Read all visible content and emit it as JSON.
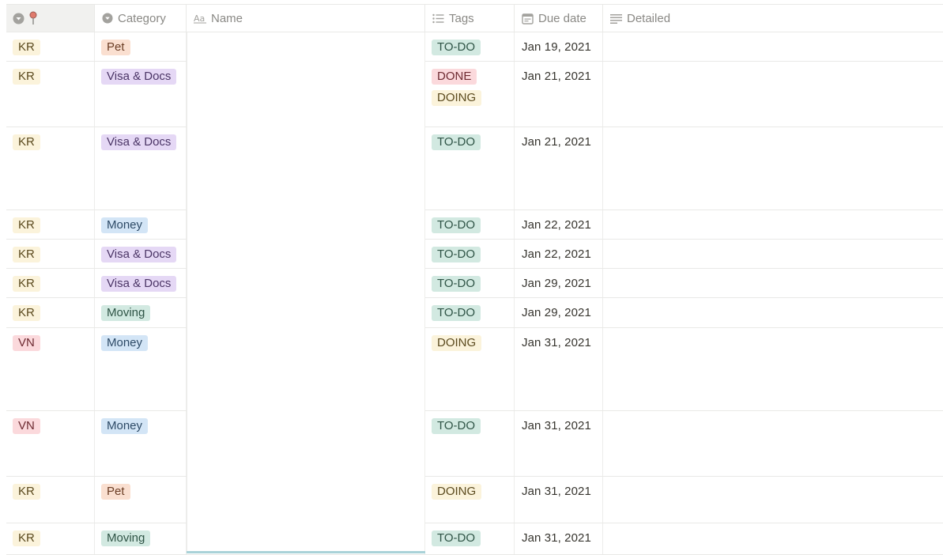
{
  "colors": {
    "yellow_bg": "#fbf3db",
    "yellow_fg": "#5b4a1e",
    "red_bg": "#fbd9dc",
    "red_fg": "#6e2b32",
    "orange_bg": "#fadfd0",
    "orange_fg": "#6b3d25",
    "purple_bg": "#e5d8f5",
    "purple_fg": "#4b3566",
    "blue_bg": "#d3e5f6",
    "blue_fg": "#2d4a66",
    "green_bg": "#d2e9e1",
    "green_fg": "#2f5446",
    "accent_strip": "#a9d2d8"
  },
  "header": {
    "region_icons": [
      "chevron-down-circle-icon",
      "pin-icon"
    ],
    "category": {
      "label": "Category",
      "icon": "chevron-down-circle-icon"
    },
    "name": {
      "label": "Name",
      "icon": "text-aa-icon"
    },
    "tags": {
      "label": "Tags",
      "icon": "list-icon"
    },
    "due": {
      "label": "Due date",
      "icon": "calendar-icon"
    },
    "detailed": {
      "label": "Detailed",
      "icon": "lines-icon"
    }
  },
  "rows": [
    {
      "region": "KR",
      "region_color": "yellow",
      "category": "Pet",
      "category_color": "orange",
      "tags": [
        {
          "label": "TO-DO",
          "color": "green"
        }
      ],
      "due": "Jan 19, 2021",
      "height_class": "h37"
    },
    {
      "region": "KR",
      "region_color": "yellow",
      "category": "Visa & Docs",
      "category_color": "purple",
      "tags": [
        {
          "label": "DONE",
          "color": "red"
        },
        {
          "label": "DOING",
          "color": "yellow"
        }
      ],
      "due": "Jan 21, 2021",
      "height_class": "h83"
    },
    {
      "region": "KR",
      "region_color": "yellow",
      "category": "Visa & Docs",
      "category_color": "purple",
      "tags": [
        {
          "label": "TO-DO",
          "color": "green"
        }
      ],
      "due": "Jan 21, 2021",
      "height_class": "h105"
    },
    {
      "region": "KR",
      "region_color": "yellow",
      "category": "Money",
      "category_color": "blue",
      "tags": [
        {
          "label": "TO-DO",
          "color": "green"
        }
      ],
      "due": "Jan 22, 2021",
      "height_class": "h37"
    },
    {
      "region": "KR",
      "region_color": "yellow",
      "category": "Visa & Docs",
      "category_color": "purple",
      "tags": [
        {
          "label": "TO-DO",
          "color": "green"
        }
      ],
      "due": "Jan 22, 2021",
      "height_class": "h37"
    },
    {
      "region": "KR",
      "region_color": "yellow",
      "category": "Visa & Docs",
      "category_color": "purple",
      "tags": [
        {
          "label": "TO-DO",
          "color": "green"
        }
      ],
      "due": "Jan 29, 2021",
      "height_class": "h37"
    },
    {
      "region": "KR",
      "region_color": "yellow",
      "category": "Moving",
      "category_color": "green",
      "tags": [
        {
          "label": "TO-DO",
          "color": "green"
        }
      ],
      "due": "Jan 29, 2021",
      "height_class": "h38"
    },
    {
      "region": "VN",
      "region_color": "red",
      "category": "Money",
      "category_color": "blue",
      "tags": [
        {
          "label": "DOING",
          "color": "yellow"
        }
      ],
      "due": "Jan 31, 2021",
      "height_class": "h105"
    },
    {
      "region": "VN",
      "region_color": "red",
      "category": "Money",
      "category_color": "blue",
      "tags": [
        {
          "label": "TO-DO",
          "color": "green"
        }
      ],
      "due": "Jan 31, 2021",
      "height_class": "h83"
    },
    {
      "region": "KR",
      "region_color": "yellow",
      "category": "Pet",
      "category_color": "orange",
      "tags": [
        {
          "label": "DOING",
          "color": "yellow"
        }
      ],
      "due": "Jan 31, 2021",
      "height_class": "h59"
    },
    {
      "region": "KR",
      "region_color": "yellow",
      "category": "Moving",
      "category_color": "green",
      "tags": [
        {
          "label": "TO-DO",
          "color": "green"
        }
      ],
      "due": "Jan 31, 2021",
      "height_class": "h40"
    }
  ]
}
